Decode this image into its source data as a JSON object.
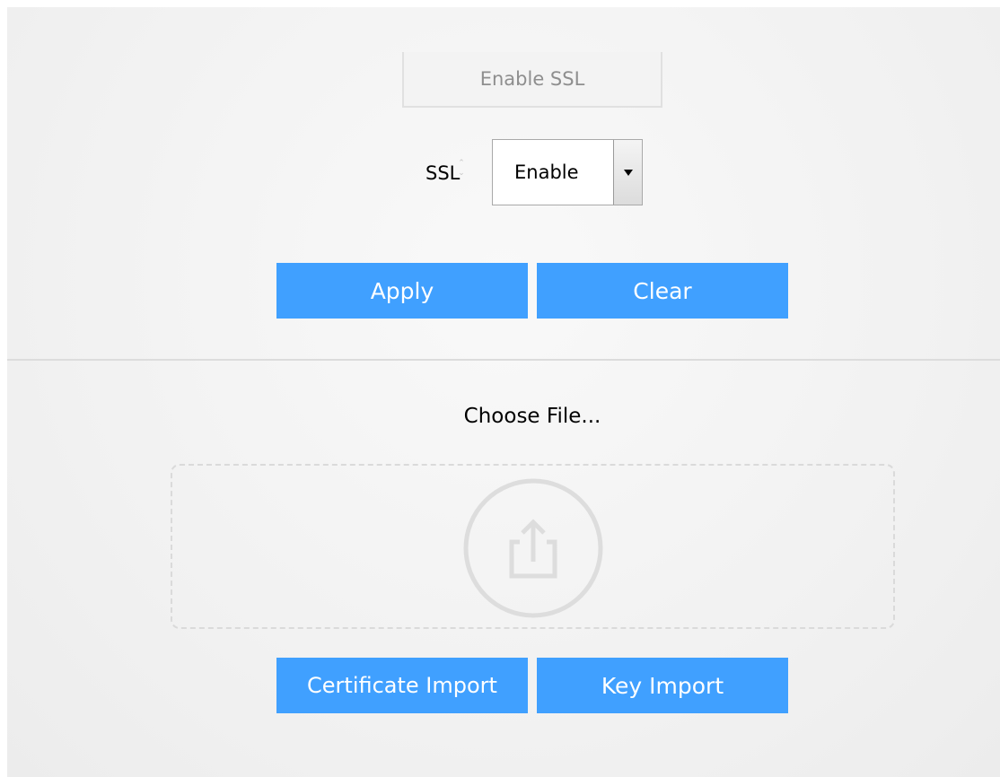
{
  "ssl_tab": {
    "label": "Enable SSL"
  },
  "ssl_setting": {
    "label": "SSL",
    "selected": "Enable"
  },
  "actions": {
    "apply_label": "Apply",
    "clear_label": "Clear"
  },
  "file_upload": {
    "heading": "Choose File...",
    "icon": "upload-icon",
    "certificate_import_label": "Certificate Import",
    "key_import_label": "Key Import"
  },
  "colors": {
    "primary_button": "#40a0ff",
    "background": "#f1f1f1"
  }
}
